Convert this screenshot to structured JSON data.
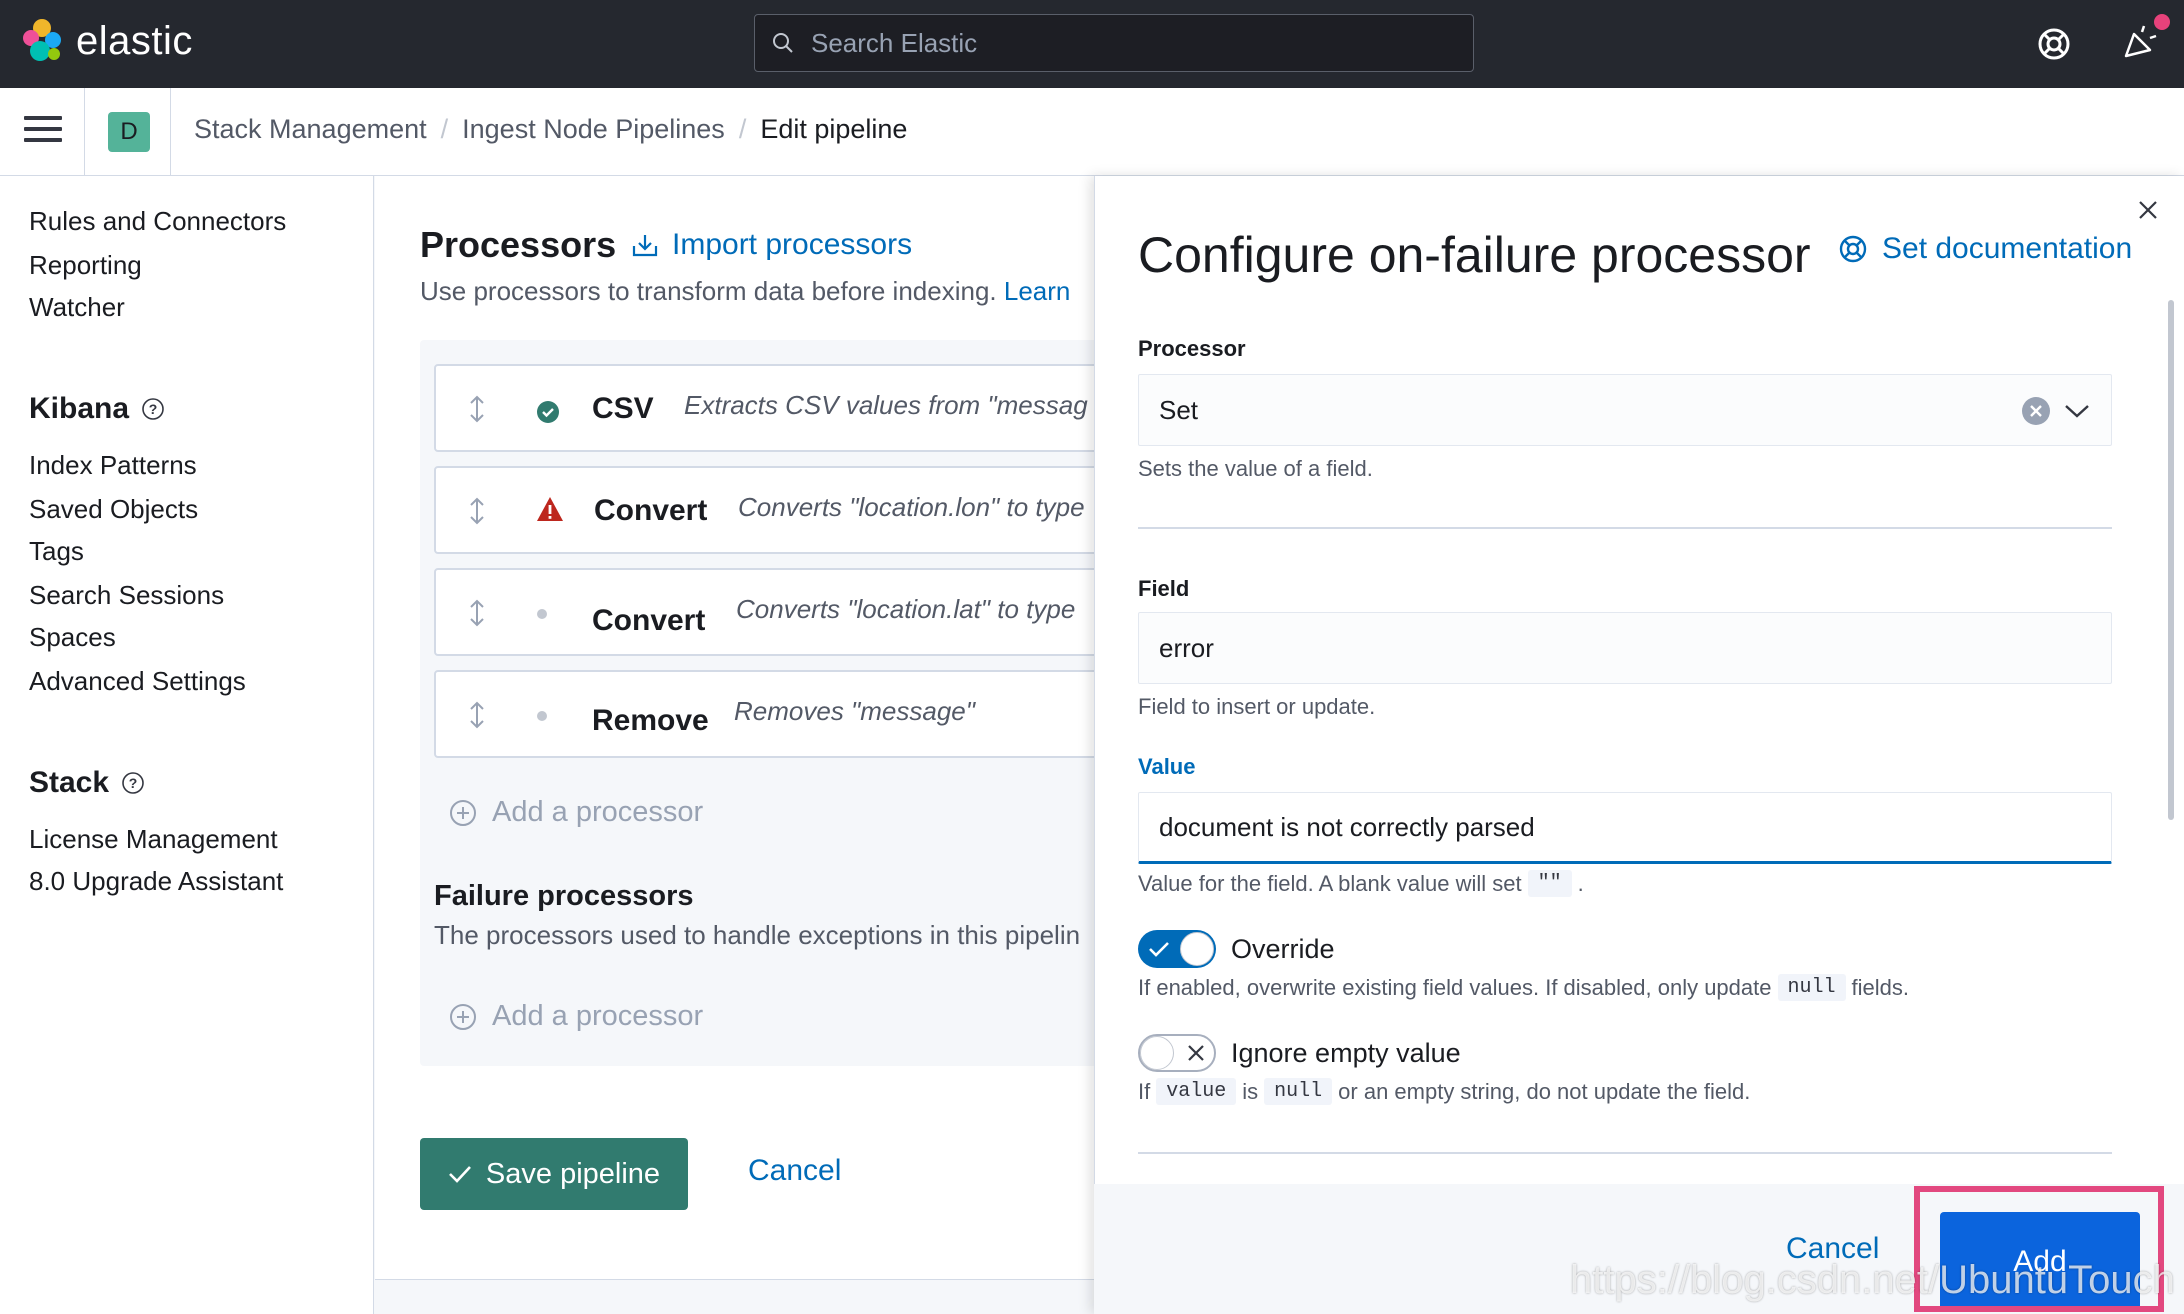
{
  "header": {
    "logo_text": "elastic",
    "search_placeholder": "Search Elastic",
    "help_icon": "lifebuoy-icon",
    "news_icon": "megaphone-icon",
    "brand_colors": [
      "#f0b62b",
      "#ef5098",
      "#00bfb3",
      "#1ba9f5",
      "#93c90e"
    ]
  },
  "breadcrumbs": {
    "space_avatar": "D",
    "items": [
      "Stack Management",
      "Ingest Node Pipelines",
      "Edit pipeline"
    ],
    "separator": "/"
  },
  "sidebar": {
    "top_items": [
      "Rules and Connectors",
      "Reporting",
      "Watcher"
    ],
    "kibana_title": "Kibana",
    "kibana_items": [
      "Index Patterns",
      "Saved Objects",
      "Tags",
      "Search Sessions",
      "Spaces",
      "Advanced Settings"
    ],
    "stack_title": "Stack",
    "stack_items": [
      "License Management",
      "8.0 Upgrade Assistant"
    ]
  },
  "processors": {
    "title": "Processors",
    "import_label": "Import processors",
    "description": "Use processors to transform data before indexing.",
    "learn_link": "Learn",
    "rows": [
      {
        "name": "CSV",
        "description": "Extracts CSV values from \"messag",
        "status": "success"
      },
      {
        "name": "Convert",
        "description": "Converts \"location.lon\" to type",
        "status": "error"
      },
      {
        "name": "Convert",
        "description": "Converts \"location.lat\" to type",
        "status": "none"
      },
      {
        "name": "Remove",
        "description": "Removes \"message\"",
        "status": "none"
      }
    ],
    "add_processor": "Add a processor",
    "failure_title": "Failure processors",
    "failure_desc": "The processors used to handle exceptions in this pipelin",
    "failure_add": "Add a processor",
    "save_label": "Save pipeline",
    "cancel_label": "Cancel"
  },
  "flyout": {
    "title": "Configure on-failure processor",
    "doc_link": "Set documentation",
    "processor_label": "Processor",
    "processor_value": "Set",
    "processor_help": "Sets the value of a field.",
    "field_label": "Field",
    "field_value": "error",
    "field_help": "Field to insert or update.",
    "value_label": "Value",
    "value_value": "document is not correctly parsed",
    "value_help_pre": "Value for the field. A blank value will set",
    "value_help_code": "\"\"",
    "value_help_post": ".",
    "override_label": "Override",
    "override_on": true,
    "override_help_pre": "If enabled, overwrite existing field values. If disabled, only update",
    "override_help_code": "null",
    "override_help_post": "fields.",
    "ignore_label": "Ignore empty value",
    "ignore_on": false,
    "ignore_help_pre": "If",
    "ignore_help_code1": "value",
    "ignore_help_mid": "is",
    "ignore_help_code2": "null",
    "ignore_help_post": "or an empty string, do not update the field.",
    "cancel_label": "Cancel",
    "add_label": "Add"
  },
  "watermark": "https://blog.csdn.net/UbuntuTouch"
}
